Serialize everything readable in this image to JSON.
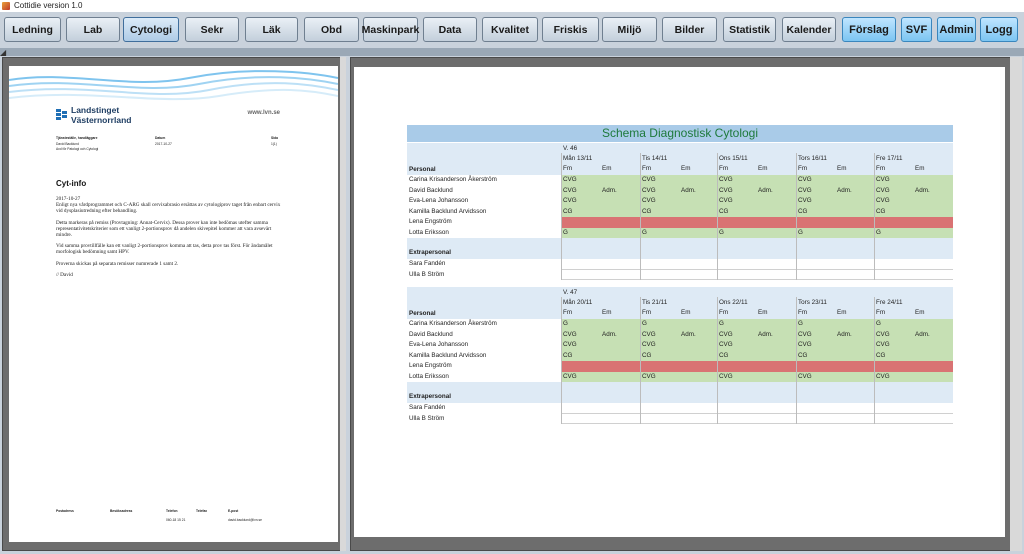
{
  "window": {
    "title": "Cottidie version 1.0"
  },
  "toolbar": {
    "buttons": [
      {
        "label": "Ledning"
      },
      {
        "label": "Lab"
      },
      {
        "label": "Cytologi"
      },
      {
        "label": "Sekr"
      },
      {
        "label": "Läk"
      },
      {
        "label": "Obd"
      },
      {
        "label": "Maskinpark"
      },
      {
        "label": "Data"
      },
      {
        "label": "Kvalitet"
      },
      {
        "label": "Friskis"
      },
      {
        "label": "Miljö"
      },
      {
        "label": "Bilder"
      },
      {
        "label": "Statistik"
      },
      {
        "label": "Kalender"
      },
      {
        "label": "Förslag"
      },
      {
        "label": "SVF"
      },
      {
        "label": "Admin"
      },
      {
        "label": "Logg"
      }
    ]
  },
  "document": {
    "org_line1": "Landstinget",
    "org_line2": "Västernorrland",
    "url": "www.lvn.se",
    "meta": {
      "label1": "Tjänsteställe, handläggare",
      "label2": "Datum",
      "label3": "Sida",
      "value1a": "David Backlund",
      "value1b": "Avd för Patologi och Cytologi",
      "value2": "2017-10-27",
      "value3": "1(1)"
    },
    "heading": "Cyt-info",
    "paragraphs": [
      "2017-10-27",
      "Enligt nya vårdprogrammet och C-ARG skall cervixabrasio ersättas av cytologiprov taget från enbart cervix vid dysplasiutredning efter behandling.",
      "Detta markeras på remiss (Provtagning: Annat-Cervix). Dessa prover kan inte bedömas utefter samma representativitetskriterier som ett vanligt 2-portionsprov då andelen skivepitel kommer att vara avsevärt mindre.",
      "Vid samma provtillfälle kan ett vanligt 2-portionsprov komma att tas, detta prov tas först. För ändamålet morfologisk bedömning samt HPV.",
      "Proverna skickas på separata remisser numrerade 1 samt 2.",
      "// David"
    ],
    "footer": {
      "label1": "Postadress",
      "label2": "Besöksadress",
      "label3": "Telefon",
      "label4": "Telefax",
      "label5": "E-post",
      "value3": "060-18 15 21",
      "value5": "david.backlund@lvn.se"
    }
  },
  "schedule": {
    "title": "Schema Diagnostisk Cytologi",
    "colors": {
      "green": "#c6e0b4",
      "red": "#d97373",
      "header": "#deeaf5",
      "title_bg": "#a9cbe8"
    },
    "weeks": [
      {
        "week": "V. 46",
        "days": [
          "Mån 13/11",
          "Tis 14/11",
          "Ons 15/11",
          "Tors 16/11",
          "Fre 17/11"
        ],
        "fm": "Fm",
        "em": "Em",
        "personal_label": "Personal",
        "extra_label": "Extrapersonal",
        "staff": [
          {
            "name": "Carina  Krisanderson Åkerström",
            "color": "green",
            "cells": [
              "CVG",
              "",
              "CVG",
              "",
              "CVG",
              "",
              "CVG",
              "",
              "CVG",
              ""
            ]
          },
          {
            "name": "David Backlund",
            "color": "green",
            "cells": [
              "CVG",
              "Adm.",
              "CVG",
              "Adm.",
              "CVG",
              "Adm.",
              "CVG",
              "Adm.",
              "CVG",
              "Adm."
            ]
          },
          {
            "name": "Eva-Lena Johansson",
            "color": "green",
            "cells": [
              "CVG",
              "",
              "CVG",
              "",
              "CVG",
              "",
              "CVG",
              "",
              "CVG",
              ""
            ]
          },
          {
            "name": "Kamilla Backlund Arvidsson",
            "color": "green",
            "cells": [
              "CG",
              "",
              "CG",
              "",
              "CG",
              "",
              "CG",
              "",
              "CG",
              ""
            ]
          },
          {
            "name": "Lena Engström",
            "color": "red",
            "cells": [
              "",
              "",
              "",
              "",
              "",
              "",
              "",
              "",
              "",
              ""
            ]
          },
          {
            "name": "Lotta Eriksson",
            "color": "green",
            "cells": [
              "G",
              "",
              "G",
              "",
              "G",
              "",
              "G",
              "",
              "G",
              ""
            ]
          }
        ],
        "extra": [
          {
            "name": "Sara Fandén"
          },
          {
            "name": "Ulla B Ström"
          }
        ]
      },
      {
        "week": "V. 47",
        "days": [
          "Mån 20/11",
          "Tis 21/11",
          "Ons 22/11",
          "Tors 23/11",
          "Fre 24/11"
        ],
        "fm": "Fm",
        "em": "Em",
        "personal_label": "Personal",
        "extra_label": "Extrapersonal",
        "staff": [
          {
            "name": "Carina  Krisanderson Åkerström",
            "color": "green",
            "cells": [
              "G",
              "",
              "G",
              "",
              "G",
              "",
              "G",
              "",
              "G",
              ""
            ]
          },
          {
            "name": "David Backlund",
            "color": "green",
            "cells": [
              "CVG",
              "Adm.",
              "CVG",
              "Adm.",
              "CVG",
              "Adm.",
              "CVG",
              "Adm.",
              "CVG",
              "Adm."
            ]
          },
          {
            "name": "Eva-Lena Johansson",
            "color": "green",
            "cells": [
              "CVG",
              "",
              "CVG",
              "",
              "CVG",
              "",
              "CVG",
              "",
              "CVG",
              ""
            ]
          },
          {
            "name": "Kamilla Backlund Arvidsson",
            "color": "green",
            "cells": [
              "CG",
              "",
              "CG",
              "",
              "CG",
              "",
              "CG",
              "",
              "CG",
              ""
            ]
          },
          {
            "name": "Lena Engström",
            "color": "red",
            "cells": [
              "",
              "",
              "",
              "",
              "",
              "",
              "",
              "",
              "",
              ""
            ]
          },
          {
            "name": "Lotta Eriksson",
            "color": "green",
            "cells": [
              "CVG",
              "",
              "CVG",
              "",
              "CVG",
              "",
              "CVG",
              "",
              "CVG",
              ""
            ]
          }
        ],
        "extra": [
          {
            "name": "Sara Fandén"
          },
          {
            "name": "Ulla B Ström"
          }
        ]
      }
    ]
  }
}
